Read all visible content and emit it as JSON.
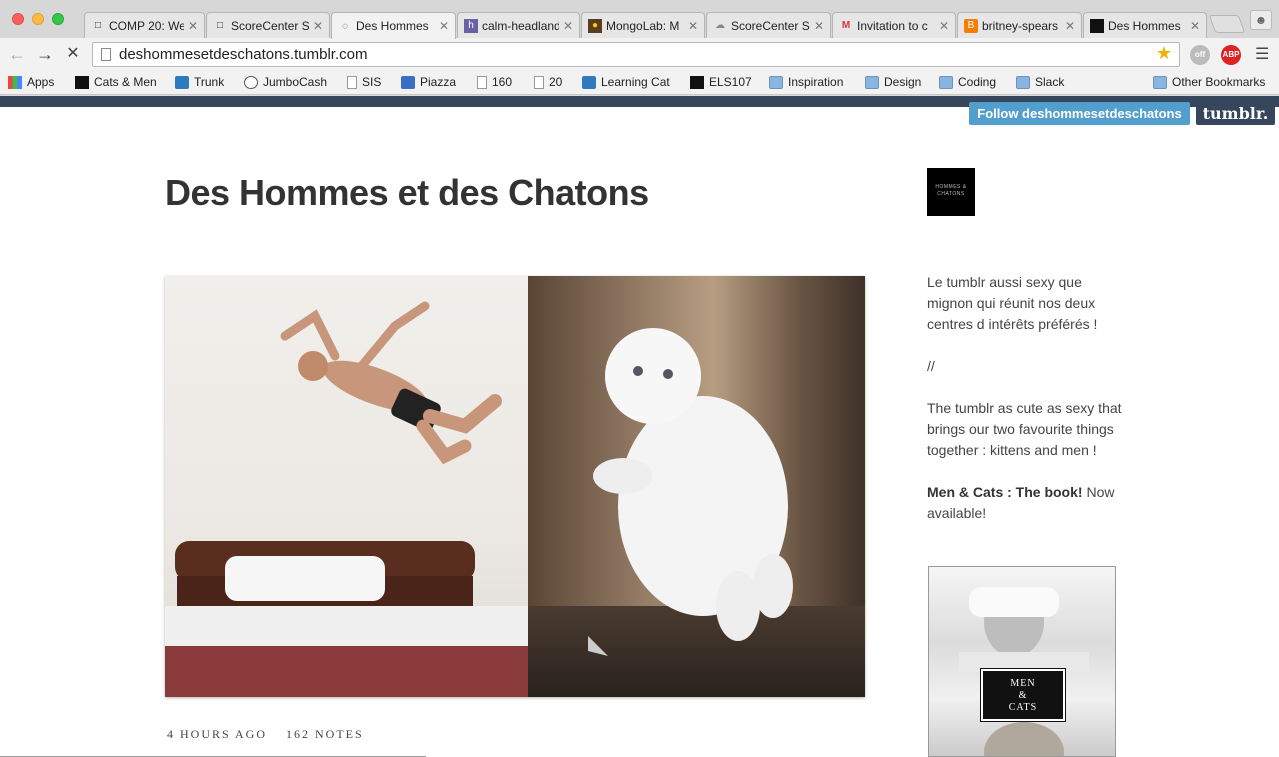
{
  "browser": {
    "tabs": [
      {
        "title": "COMP 20: We",
        "icon": "page-icon"
      },
      {
        "title": "ScoreCenter S",
        "icon": "page-icon"
      },
      {
        "title": "Des Hommes",
        "icon": "loading-spinner-icon",
        "active": true
      },
      {
        "title": "calm-headland",
        "icon": "heroku-icon"
      },
      {
        "title": "MongoLab: M",
        "icon": "mongolab-icon"
      },
      {
        "title": "ScoreCenter S",
        "icon": "cloud-icon"
      },
      {
        "title": "Invitation to c",
        "icon": "gmail-icon"
      },
      {
        "title": "britney-spears",
        "icon": "blogger-icon"
      },
      {
        "title": "Des Hommes",
        "icon": "tumblr-favicon-icon"
      }
    ],
    "url": "deshommesetdeschatons.tumblr.com",
    "bookmarks": [
      {
        "label": "Apps",
        "icon": "apps-icon"
      },
      {
        "label": "Cats & Men",
        "icon": "bookmark-favicon-icon"
      },
      {
        "label": "Trunk",
        "icon": "trunk-icon"
      },
      {
        "label": "JumboCash",
        "icon": "globe-icon"
      },
      {
        "label": "SIS",
        "icon": "page-icon"
      },
      {
        "label": "Piazza",
        "icon": "piazza-icon"
      },
      {
        "label": "160",
        "icon": "page-icon"
      },
      {
        "label": "20",
        "icon": "page-icon"
      },
      {
        "label": "Learning Cat",
        "icon": "learning-cat-icon"
      },
      {
        "label": "ELS107",
        "icon": "hb-icon"
      },
      {
        "label": "Inspiration",
        "icon": "folder-icon"
      },
      {
        "label": "Design",
        "icon": "folder-icon"
      },
      {
        "label": "Coding",
        "icon": "folder-icon"
      },
      {
        "label": "Slack",
        "icon": "folder-icon"
      },
      {
        "label": "Other Bookmarks",
        "icon": "folder-icon"
      }
    ],
    "extensions": {
      "abp_label": "ABP",
      "cat_badge": "off"
    }
  },
  "page": {
    "follow_label": "Follow deshommesetdeschatons",
    "tumblr_logo": "tumblr.",
    "blog_title": "Des Hommes et des Chatons",
    "avatar_text": "HOMMES & CHATONS",
    "post": {
      "time": "4 HOURS AGO",
      "notes": "162 NOTES"
    },
    "description": {
      "fr": "Le tumblr aussi sexy que mignon qui réunit nos deux centres d intérêts préférés !",
      "sep": "//",
      "en": "The tumblr as cute as sexy that brings our two favourite things together : kittens and men !",
      "book_bold": "Men & Cats : The book!",
      "book_rest": " Now available!"
    },
    "book_badge": {
      "line1": "MEN",
      "line2": "&",
      "line3": "CATS"
    }
  }
}
